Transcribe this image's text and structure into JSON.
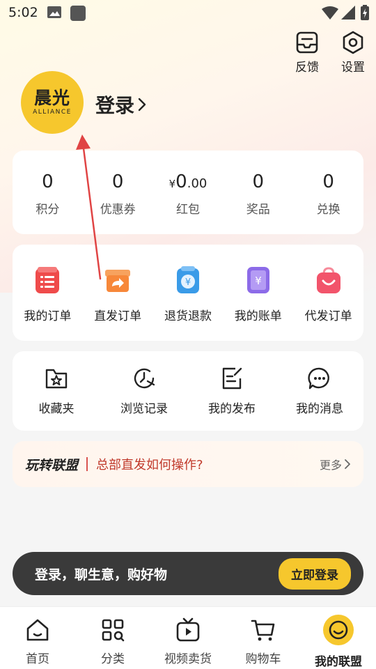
{
  "status_bar": {
    "time": "5:02"
  },
  "header": {
    "feedback_label": "反馈",
    "settings_label": "设置"
  },
  "profile": {
    "avatar_logo": "晨光",
    "avatar_sub": "ALLIANCE",
    "login_label": "登录"
  },
  "stats": [
    {
      "value": "0",
      "label": "积分"
    },
    {
      "value": "0",
      "label": "优惠券"
    },
    {
      "currency": "¥",
      "value": "0",
      "decimal": ".00",
      "label": "红包"
    },
    {
      "value": "0",
      "label": "奖品"
    },
    {
      "value": "0",
      "label": "兑换"
    }
  ],
  "orders": [
    {
      "label": "我的订单",
      "icon": "order-list-icon",
      "color": "#ef4b4b"
    },
    {
      "label": "直发订单",
      "icon": "direct-ship-icon",
      "color": "#f7883a"
    },
    {
      "label": "退货退款",
      "icon": "refund-icon",
      "color": "#3a9be8"
    },
    {
      "label": "我的账单",
      "icon": "bill-icon",
      "color": "#8c6be8"
    },
    {
      "label": "代发订单",
      "icon": "dropship-bag-icon",
      "color": "#f2546b"
    }
  ],
  "tools": [
    {
      "label": "收藏夹",
      "icon": "favorites-folder-icon"
    },
    {
      "label": "浏览记录",
      "icon": "history-clock-icon"
    },
    {
      "label": "我的发布",
      "icon": "publish-edit-icon"
    },
    {
      "label": "我的消息",
      "icon": "message-bubble-icon"
    }
  ],
  "tips": {
    "title": "玩转联盟",
    "question": "总部直发如何操作?",
    "more": "更多"
  },
  "login_banner": {
    "text": "登录，聊生意，购好物",
    "button": "立即登录"
  },
  "bottom_nav": [
    {
      "label": "首页",
      "icon": "home-icon"
    },
    {
      "label": "分类",
      "icon": "category-grid-icon"
    },
    {
      "label": "视频卖货",
      "icon": "video-tv-icon"
    },
    {
      "label": "购物车",
      "icon": "cart-icon"
    },
    {
      "label": "我的联盟",
      "icon": "smiley-profile-icon",
      "active": true
    }
  ],
  "colors": {
    "brand_yellow": "#f6c72d",
    "annotation_red": "#e04444",
    "banner_dark": "#3a3a3a"
  }
}
